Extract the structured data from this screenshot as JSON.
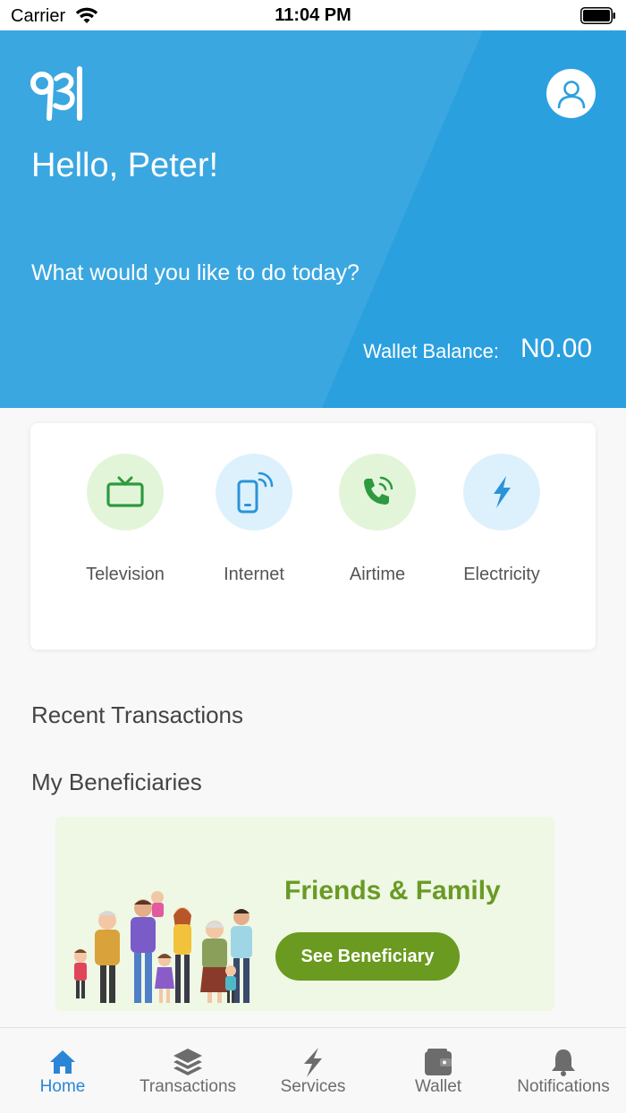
{
  "status_bar": {
    "carrier": "Carrier",
    "time": "11:04 PM"
  },
  "header": {
    "logo_text": "931",
    "greeting": "Hello, Peter!",
    "prompt": "What would you like to do today?",
    "wallet_label": "Wallet Balance:",
    "wallet_value": "N0.00",
    "background_color": "#2ba0df"
  },
  "services": [
    {
      "label": "Television",
      "icon": "tv-icon",
      "color": "#2d9a3f",
      "bg": "#e3f5d9"
    },
    {
      "label": "Internet",
      "icon": "mobile-wifi-icon",
      "color": "#2b94d8",
      "bg": "#ddf1fd"
    },
    {
      "label": "Airtime",
      "icon": "phone-call-icon",
      "color": "#2d9a3f",
      "bg": "#e3f5d9"
    },
    {
      "label": "Electricity",
      "icon": "lightning-icon",
      "color": "#2b94d8",
      "bg": "#ddf1fd"
    }
  ],
  "sections": {
    "recent_transactions": "Recent Transactions",
    "my_beneficiaries": "My Beneficiaries"
  },
  "beneficiary_card": {
    "title": "Friends & Family",
    "button_label": "See Beneficiary",
    "illustration": "family-illustration"
  },
  "tabs": [
    {
      "label": "Home",
      "icon": "home-icon",
      "active": true
    },
    {
      "label": "Transactions",
      "icon": "layers-icon",
      "active": false
    },
    {
      "label": "Services",
      "icon": "lightning-icon",
      "active": false
    },
    {
      "label": "Wallet",
      "icon": "wallet-icon",
      "active": false
    },
    {
      "label": "Notifications",
      "icon": "bell-icon",
      "active": false
    }
  ],
  "colors": {
    "accent": "#2b85d6",
    "green": "#6a9a1f",
    "inactive": "#6c6c6c"
  }
}
